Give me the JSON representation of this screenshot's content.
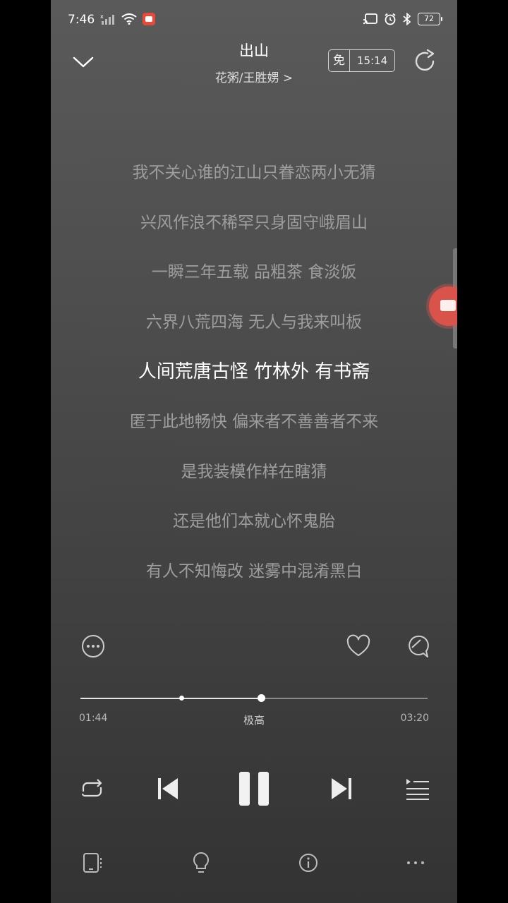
{
  "status_bar": {
    "time": "7:46",
    "battery": "72"
  },
  "header": {
    "title": "出山",
    "artist": "花粥/王胜娚 >",
    "free_label": "免",
    "free_time": "15:14"
  },
  "lyrics": [
    {
      "text": "我不关心谁的江山只眷恋两小无猜",
      "active": false
    },
    {
      "text": "兴风作浪不稀罕只身固守峨眉山",
      "active": false
    },
    {
      "text": "一瞬三年五载 品粗茶 食淡饭",
      "active": false
    },
    {
      "text": "六界八荒四海 无人与我来叫板",
      "active": false
    },
    {
      "text": "人间荒唐古怪 竹林外 有书斋",
      "active": true
    },
    {
      "text": "匿于此地畅快 偏来者不善善者不来",
      "active": false
    },
    {
      "text": "是我装模作样在瞎猜",
      "active": false
    },
    {
      "text": "还是他们本就心怀鬼胎",
      "active": false
    },
    {
      "text": "有人不知悔改 迷雾中混淆黑白",
      "active": false
    }
  ],
  "player": {
    "current_time": "01:44",
    "total_time": "03:20",
    "quality": "极高",
    "progress": 0.52,
    "buffered": 0.29
  },
  "icons": {
    "collapse": "chevron-down-icon",
    "share": "share-icon",
    "more": "more-circle-icon",
    "like": "heart-icon",
    "comment": "comment-icon",
    "repeat": "repeat-icon",
    "prev": "previous-icon",
    "pause": "pause-icon",
    "next": "next-icon",
    "playlist": "playlist-icon",
    "device": "device-icon",
    "tip": "lightbulb-icon",
    "info": "info-icon",
    "menu": "ellipsis-icon"
  }
}
